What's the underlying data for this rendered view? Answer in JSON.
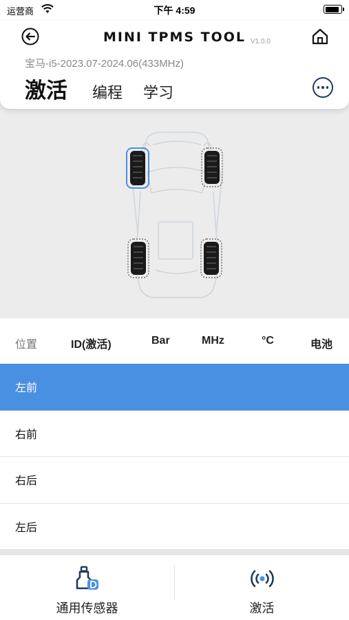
{
  "status_bar": {
    "carrier": "运营商",
    "time": "下午 4:59",
    "battery_level": 0.9
  },
  "header": {
    "app_title": "MINI TPMS TOOL",
    "version": "V1.0.0",
    "vehicle": "宝马-i5-2023.07-2024.06(433MHz)",
    "back_icon": "back-arrow-icon",
    "home_icon": "home-icon",
    "more_icon": "more-icon"
  },
  "tabs": [
    {
      "label": "激活",
      "active": true
    },
    {
      "label": "编程",
      "active": false
    },
    {
      "label": "学习",
      "active": false
    }
  ],
  "car": {
    "selected_wheel": "front-left",
    "accent_color": "#4a90e2"
  },
  "table": {
    "headers": [
      "位置",
      "ID(激活)",
      "Bar",
      "MHz",
      "°C",
      "电池"
    ],
    "rows": [
      {
        "position": "左前",
        "selected": true
      },
      {
        "position": "右前",
        "selected": false
      },
      {
        "position": "右后",
        "selected": false
      },
      {
        "position": "左后",
        "selected": false
      }
    ]
  },
  "bottom_bar": {
    "items": [
      {
        "label": "通用传感器",
        "icon": "sensor-icon"
      },
      {
        "label": "激活",
        "icon": "activate-signal-icon"
      }
    ]
  },
  "colors": {
    "selected_row": "#4a90e2",
    "icon_dark": "#1e3a5f"
  }
}
